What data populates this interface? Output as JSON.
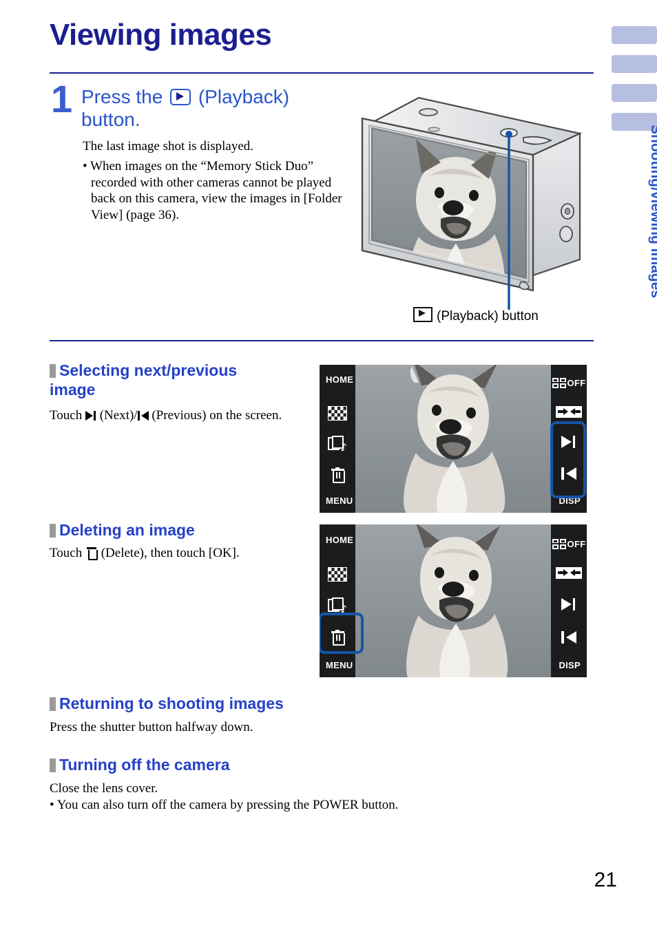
{
  "page": {
    "title": "Viewing images",
    "number": "21",
    "side_tab_label": "Shooting/viewing images",
    "side_tab_chip_count": 4,
    "accent_navy": "#1b1f8f",
    "accent_blue": "#2441c8",
    "tab_chip_color": "#b6bfe0",
    "highlight_color": "#1456a8"
  },
  "step1": {
    "number": "1",
    "heading_before": "Press the",
    "heading_icon": "playback-icon",
    "heading_after": "(Playback) button.",
    "result_text": "The last image shot is displayed.",
    "bullet": "• When images on the “Memory Stick Duo” recorded with other cameras cannot be played back on this camera, view the images in [Folder View] (page 36)."
  },
  "camera_figure": {
    "caption_icon": "playback-icon",
    "caption_text": "(Playback) button",
    "callout_target": "playback-button-on-camera"
  },
  "sections": [
    {
      "id": "selecting",
      "heading": "Selecting next/previous image",
      "body_before": "Touch",
      "body_mid": "(Next)/",
      "body_after": "(Previous) on the screen."
    },
    {
      "id": "deleting",
      "heading": "Deleting an image",
      "body_before": "Touch",
      "body_after": "(Delete), then touch [OK]."
    },
    {
      "id": "returning",
      "heading": "Returning to shooting images",
      "body": "Press the shutter button halfway down."
    },
    {
      "id": "turning-off",
      "heading": "Turning off the camera",
      "body": "Close the lens cover.",
      "bullet": "• You can also turn off the camera by pressing the POWER button."
    }
  ],
  "lcd_screens": [
    {
      "id": "screen-next-previous",
      "left_controls": [
        {
          "name": "home-label",
          "label": "HOME"
        },
        {
          "name": "index-icon",
          "label": ""
        },
        {
          "name": "slideshow-icon",
          "label": ""
        },
        {
          "name": "delete-icon",
          "label": ""
        },
        {
          "name": "menu-label",
          "label": "MENU"
        }
      ],
      "right_controls": [
        {
          "name": "burst-grid-icon",
          "label": "OFF"
        },
        {
          "name": "pan-arrows-icon",
          "label": ""
        },
        {
          "name": "next-image-icon",
          "label": ""
        },
        {
          "name": "previous-image-icon",
          "label": ""
        },
        {
          "name": "disp-label",
          "label": "DISP"
        }
      ],
      "highlight": "next-previous-buttons",
      "photo_subject": "shiba inu dog"
    },
    {
      "id": "screen-delete",
      "left_controls": [
        {
          "name": "home-label",
          "label": "HOME"
        },
        {
          "name": "index-icon",
          "label": ""
        },
        {
          "name": "slideshow-icon",
          "label": ""
        },
        {
          "name": "delete-icon",
          "label": ""
        },
        {
          "name": "menu-label",
          "label": "MENU"
        }
      ],
      "right_controls": [
        {
          "name": "burst-grid-icon",
          "label": "OFF"
        },
        {
          "name": "pan-arrows-icon",
          "label": ""
        },
        {
          "name": "next-image-icon",
          "label": ""
        },
        {
          "name": "previous-image-icon",
          "label": ""
        },
        {
          "name": "disp-label",
          "label": "DISP"
        }
      ],
      "highlight": "delete-button",
      "photo_subject": "shiba inu dog"
    }
  ]
}
